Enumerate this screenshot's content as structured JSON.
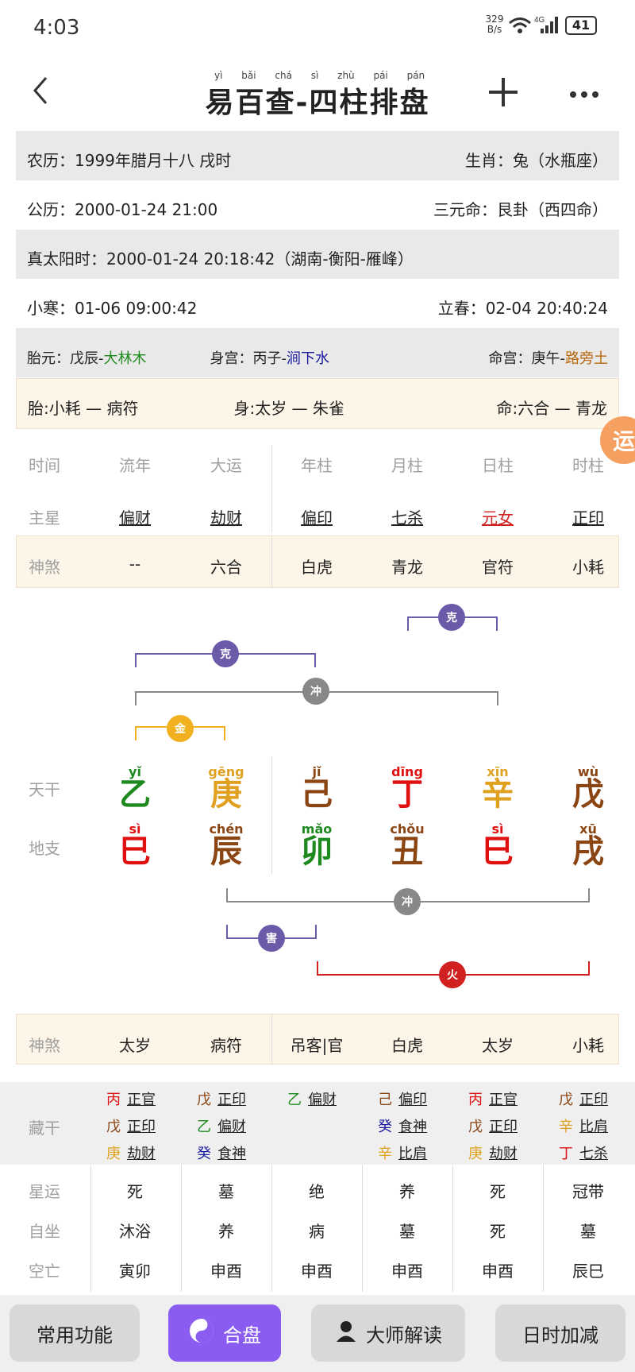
{
  "status": {
    "time": "4:03",
    "net_speed": "329\nB/s",
    "network": "4G",
    "battery": "41"
  },
  "header": {
    "title": "易百查-四柱排盘",
    "title_pinyin": "yì bǎi chá sì zhù pái pán"
  },
  "info": {
    "lunar": "农历：1999年腊月十八 戌时",
    "zodiac": "生肖：兔（水瓶座）",
    "solar": "公历：2000-01-24 21:00",
    "sanyuan": "三元命：艮卦（西四命）",
    "truesolar": "真太阳时：2000-01-24 20:18:42（湖南-衡阳-雁峰）",
    "xiaohan": "小寒：01-06 09:00:42",
    "lichun": "立春：02-04 20:40:24",
    "taiyuan_label": "胎元：戊辰-",
    "taiyuan_val": "大林木",
    "shengong_label": "身宫：丙子-",
    "shengong_val": "涧下水",
    "minggong_label": "命宫：庚午-",
    "minggong_val": "路旁土",
    "tai": "胎:小耗 — 病符",
    "shen": "身:太岁 — 朱雀",
    "ming": "命:六合 — 青龙"
  },
  "float_btn": "运",
  "cols": {
    "labels": [
      "时间",
      "流年",
      "大运",
      "年柱",
      "月柱",
      "日柱",
      "时柱"
    ],
    "zhuxing_label": "主星",
    "zhuxing": [
      "偏财",
      "劫财",
      "偏印",
      "七杀",
      "元女",
      "正印"
    ],
    "shensha_label": "神煞",
    "shensha": [
      "--",
      "六合",
      "白虎",
      "青龙",
      "官符",
      "小耗"
    ]
  },
  "relations": {
    "top1": "克",
    "top2": "克",
    "top3": "冲",
    "top4": "金",
    "b1": "冲",
    "b2": "害",
    "b3": "火"
  },
  "tiangan_label": "天干",
  "dizhi_label": "地支",
  "tiangan": [
    {
      "char": "乙",
      "py": "yǐ",
      "color": "#1e8a1e"
    },
    {
      "char": "庚",
      "py": "gēng",
      "color": "#e0a020"
    },
    {
      "char": "己",
      "py": "jǐ",
      "color": "#8b4513"
    },
    {
      "char": "丁",
      "py": "dīng",
      "color": "#e01010"
    },
    {
      "char": "辛",
      "py": "xīn",
      "color": "#e0a020"
    },
    {
      "char": "戊",
      "py": "wù",
      "color": "#8b4513"
    }
  ],
  "dizhi": [
    {
      "char": "巳",
      "py": "sì",
      "color": "#e01010"
    },
    {
      "char": "辰",
      "py": "chén",
      "color": "#8b4513"
    },
    {
      "char": "卯",
      "py": "mǎo",
      "color": "#1e8a1e"
    },
    {
      "char": "丑",
      "py": "chǒu",
      "color": "#8b4513"
    },
    {
      "char": "巳",
      "py": "sì",
      "color": "#e01010"
    },
    {
      "char": "戌",
      "py": "xū",
      "color": "#8b4513"
    }
  ],
  "shensha2": [
    "太岁",
    "病符",
    "吊客|官",
    "白虎",
    "太岁",
    "小耗"
  ],
  "canggan_label": "藏干",
  "canggan": [
    [
      [
        "丙",
        "正官",
        "#e01010"
      ],
      [
        "戊",
        "正印",
        "#8b4513"
      ],
      [
        "庚",
        "劫财",
        "#e0a020"
      ]
    ],
    [
      [
        "戊",
        "正印",
        "#8b4513"
      ],
      [
        "乙",
        "偏财",
        "#1e8a1e"
      ],
      [
        "癸",
        "食神",
        "#1a1aa0"
      ]
    ],
    [
      [
        "乙",
        "偏财",
        "#1e8a1e"
      ]
    ],
    [
      [
        "己",
        "偏印",
        "#8b4513"
      ],
      [
        "癸",
        "食神",
        "#1a1aa0"
      ],
      [
        "辛",
        "比肩",
        "#e0a020"
      ]
    ],
    [
      [
        "丙",
        "正官",
        "#e01010"
      ],
      [
        "戊",
        "正印",
        "#8b4513"
      ],
      [
        "庚",
        "劫财",
        "#e0a020"
      ]
    ],
    [
      [
        "戊",
        "正印",
        "#8b4513"
      ],
      [
        "辛",
        "比肩",
        "#e0a020"
      ],
      [
        "丁",
        "七杀",
        "#e01010"
      ]
    ]
  ],
  "xingyun_label": "星运",
  "xingyun": [
    "死",
    "墓",
    "绝",
    "养",
    "死",
    "冠带"
  ],
  "zizuo_label": "自坐",
  "zizuo": [
    "沐浴",
    "养",
    "病",
    "墓",
    "死",
    "墓"
  ],
  "kongwang_label": "空亡",
  "kongwang": [
    "寅卯",
    "申酉",
    "申酉",
    "申酉",
    "申酉",
    "辰巳"
  ],
  "bottom": {
    "b1": "常用功能",
    "b2": "合盘",
    "b3": "大师解读",
    "b4": "日时加减"
  }
}
